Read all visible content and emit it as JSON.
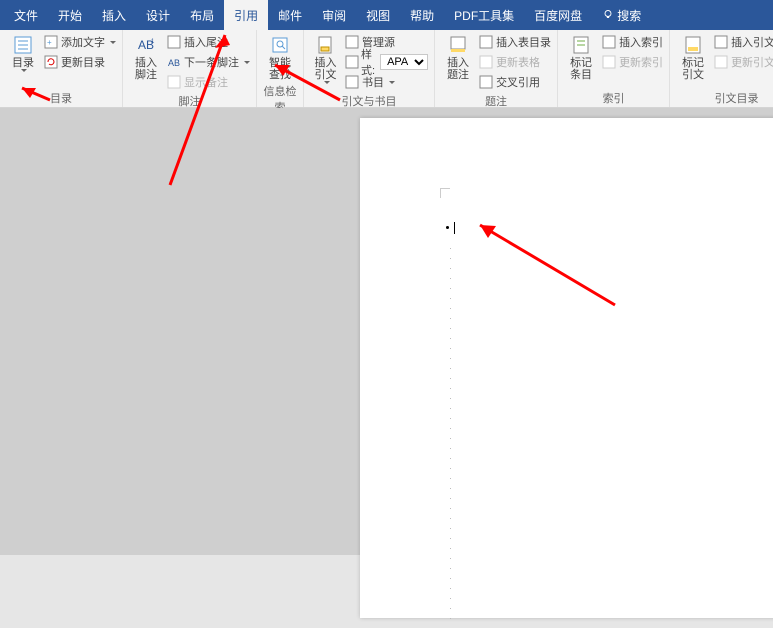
{
  "menubar": {
    "items": [
      "文件",
      "开始",
      "插入",
      "设计",
      "布局",
      "引用",
      "邮件",
      "审阅",
      "视图",
      "帮助",
      "PDF工具集",
      "百度网盘"
    ],
    "active_index": 5,
    "search_label": "搜索"
  },
  "ribbon": {
    "groups": [
      {
        "label": "目录",
        "big": {
          "label": "目录"
        },
        "items": [
          "添加文字",
          "更新目录"
        ]
      },
      {
        "label": "脚注",
        "big": {
          "label": "插入脚注"
        },
        "items": [
          "插入尾注",
          "下一条脚注",
          "显示备注"
        ],
        "disabled": [
          2
        ]
      },
      {
        "label": "信息检索",
        "big": {
          "label": "智能\n查找"
        }
      },
      {
        "label": "引文与书目",
        "big": {
          "label": "插入引文"
        },
        "items": [
          "管理源",
          "样式:",
          "书目"
        ],
        "style_value": "APA"
      },
      {
        "label": "题注",
        "big": {
          "label": "插入题注"
        },
        "items": [
          "插入表目录",
          "更新表格",
          "交叉引用"
        ],
        "disabled": [
          1
        ]
      },
      {
        "label": "索引",
        "big": {
          "label": "标记\n条目"
        },
        "items": [
          "插入索引",
          "更新索引"
        ],
        "disabled": [
          1
        ]
      },
      {
        "label": "引文目录",
        "big": {
          "label": "标记引文"
        },
        "items": [
          "插入引文目录",
          "更新引文目录"
        ],
        "disabled": [
          1
        ]
      }
    ]
  }
}
